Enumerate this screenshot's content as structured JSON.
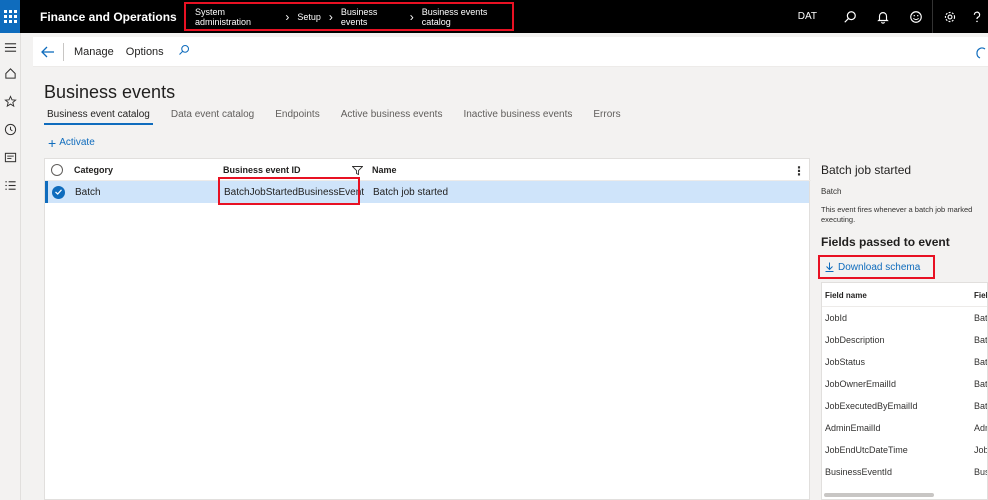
{
  "topbar": {
    "app_title": "Finance and Operations",
    "breadcrumb": [
      "System administration",
      "Setup",
      "Business events",
      "Business events catalog"
    ],
    "company": "DAT"
  },
  "actionpane": {
    "manage": "Manage",
    "options": "Options"
  },
  "page": {
    "title": "Business events",
    "tabs": [
      "Business event catalog",
      "Data event catalog",
      "Endpoints",
      "Active business events",
      "Inactive business events",
      "Errors"
    ],
    "activate_label": "Activate"
  },
  "grid": {
    "headers": {
      "category": "Category",
      "event_id": "Business event ID",
      "name": "Name"
    },
    "rows": [
      {
        "category": "Batch",
        "event_id": "BatchJobStartedBusinessEvent",
        "name": "Batch job started"
      }
    ]
  },
  "details": {
    "title": "Batch job started",
    "category": "Batch",
    "description": "This event fires whenever a batch job marked executing.",
    "fields_heading": "Fields passed to event",
    "download_label": "Download schema",
    "table_headers": [
      "Field name",
      "Field"
    ],
    "fields": [
      {
        "name": "JobId",
        "type": "Batc"
      },
      {
        "name": "JobDescription",
        "type": "Batc"
      },
      {
        "name": "JobStatus",
        "type": "Batc"
      },
      {
        "name": "JobOwnerEmailId",
        "type": "Batc"
      },
      {
        "name": "JobExecutedByEmailId",
        "type": "Batc"
      },
      {
        "name": "AdminEmailId",
        "type": "Adm"
      },
      {
        "name": "JobEndUtcDateTime",
        "type": "Job"
      },
      {
        "name": "BusinessEventId",
        "type": "Busi"
      }
    ]
  }
}
